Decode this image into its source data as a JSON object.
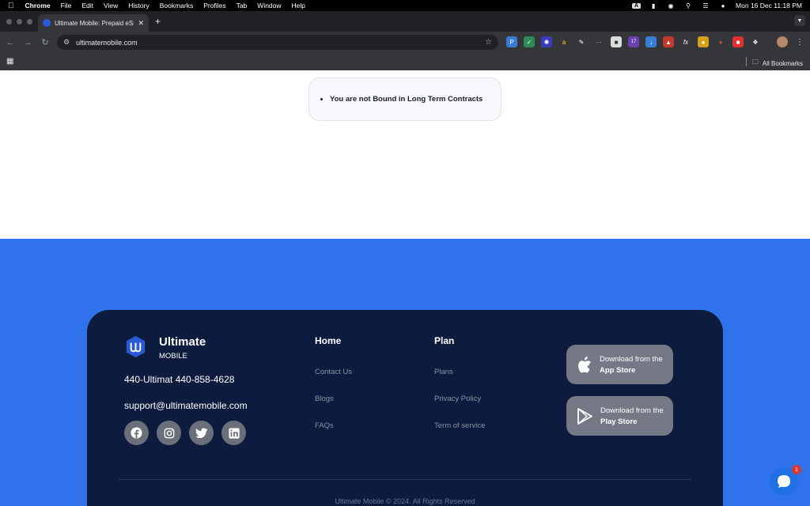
{
  "menubar": {
    "items": [
      "Chrome",
      "File",
      "Edit",
      "View",
      "History",
      "Bookmarks",
      "Profiles",
      "Tab",
      "Window",
      "Help"
    ],
    "input_source": "A",
    "clock": "Mon 16 Dec  11:18 PM"
  },
  "browser": {
    "tab_title": "Ultimate Mobile: Prepaid eSIM",
    "url": "ultimatemobile.com",
    "extension_badge": "17",
    "bookmarks_label": "All Bookmarks"
  },
  "page": {
    "bullet": "You are not Bound in Long Term Contracts"
  },
  "footer": {
    "brand_name": "Ultimate",
    "brand_sub": "MOBILE",
    "phone": "440-Ultimat 440-858-4628",
    "email": "support@ultimatemobile.com",
    "col1_title": "Home",
    "col1_links": [
      "Contact Us",
      "Blogs",
      "FAQs"
    ],
    "col2_title": "Plan",
    "col2_links": [
      "Plans",
      "Privacy Policy",
      "Term of service"
    ],
    "app_store": {
      "line1": "Download from the",
      "line2": "App Store"
    },
    "play_store": {
      "line1": "Download from the",
      "line2": "Play Store"
    },
    "copyright": "Ultimate Mobile © 2024. All Rights Reserved"
  },
  "chat": {
    "badge": "1"
  },
  "colors": {
    "blue_band": "#2f72ec",
    "footer_bg": "#0d1b3e",
    "store_button": "#747985"
  }
}
